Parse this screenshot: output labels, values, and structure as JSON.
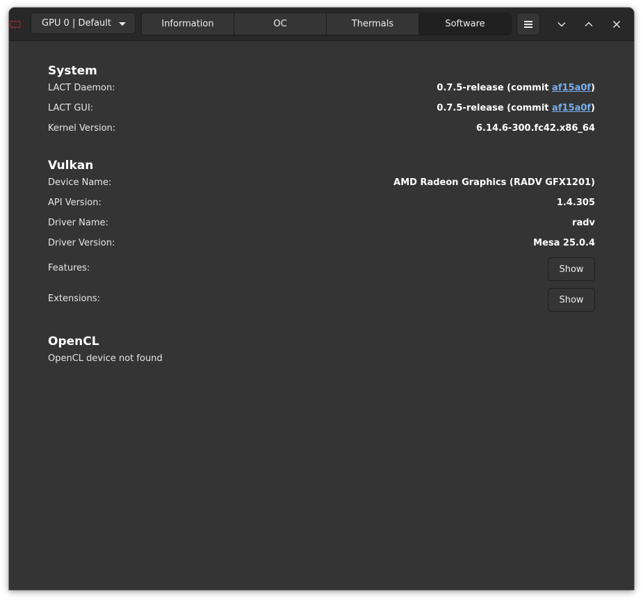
{
  "header": {
    "gpu_select": {
      "value": "GPU 0 | Default"
    },
    "tabs": [
      {
        "label": "Information",
        "active": false
      },
      {
        "label": "OC",
        "active": false
      },
      {
        "label": "Thermals",
        "active": false
      },
      {
        "label": "Software",
        "active": true
      }
    ],
    "icons": {
      "app": "lact-app-icon",
      "menu": "hamburger-menu-icon",
      "minimize": "chevron-down-icon",
      "maximize": "chevron-up-icon",
      "close": "close-icon"
    }
  },
  "system": {
    "title": "System",
    "daemon": {
      "label": "LACT Daemon:",
      "value_prefix": "0.7.5-release (commit ",
      "commit": "af15a0f",
      "value_suffix": ")"
    },
    "gui": {
      "label": "LACT GUI:",
      "value_prefix": "0.7.5-release (commit ",
      "commit": "af15a0f",
      "value_suffix": ")"
    },
    "kernel": {
      "label": "Kernel Version:",
      "value": "6.14.6-300.fc42.x86_64"
    }
  },
  "vulkan": {
    "title": "Vulkan",
    "device_name": {
      "label": "Device Name:",
      "value": "AMD Radeon Graphics (RADV GFX1201)"
    },
    "api_version": {
      "label": "API Version:",
      "value": "1.4.305"
    },
    "driver_name": {
      "label": "Driver Name:",
      "value": "radv"
    },
    "driver_version": {
      "label": "Driver Version:",
      "value": "Mesa 25.0.4"
    },
    "features": {
      "label": "Features:",
      "button": "Show"
    },
    "extensions": {
      "label": "Extensions:",
      "button": "Show"
    }
  },
  "opencl": {
    "title": "OpenCL",
    "status": "OpenCL device not found"
  },
  "colors": {
    "window_bg": "#343434",
    "headerbar_bg": "#282828",
    "link": "#78aeed",
    "active_tab": "#202020"
  }
}
